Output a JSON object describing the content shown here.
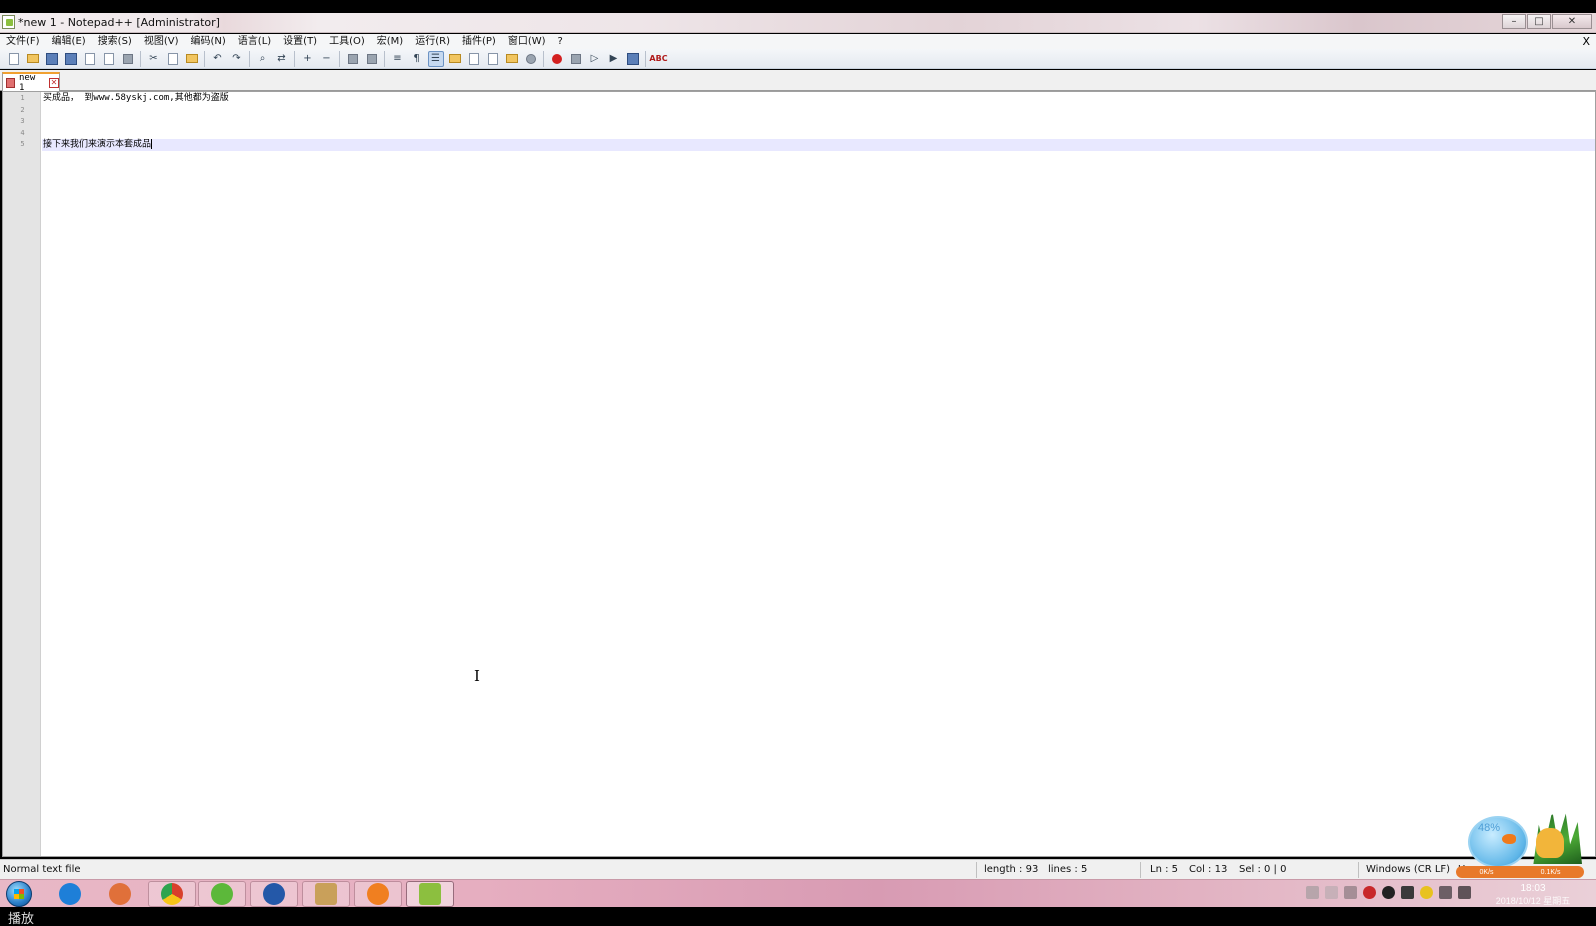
{
  "window": {
    "title": "*new 1 - Notepad++ [Administrator]",
    "buttons": {
      "minimize": "–",
      "maximize": "□",
      "close": "✕"
    }
  },
  "menu": {
    "items": [
      {
        "label": "文件(F)"
      },
      {
        "label": "编辑(E)"
      },
      {
        "label": "搜索(S)"
      },
      {
        "label": "视图(V)"
      },
      {
        "label": "编码(N)"
      },
      {
        "label": "语言(L)"
      },
      {
        "label": "设置(T)"
      },
      {
        "label": "工具(O)"
      },
      {
        "label": "宏(M)"
      },
      {
        "label": "运行(R)"
      },
      {
        "label": "插件(P)"
      },
      {
        "label": "窗口(W)"
      },
      {
        "label": "?"
      }
    ],
    "close_doc": "X"
  },
  "toolbar": {
    "icons": [
      "new-file-icon",
      "open-file-icon",
      "save-icon",
      "save-all-icon",
      "close-icon",
      "close-all-icon",
      "print-icon",
      "cut-icon",
      "copy-icon",
      "paste-icon",
      "undo-icon",
      "redo-icon",
      "find-icon",
      "replace-icon",
      "zoom-in-icon",
      "zoom-out-icon",
      "sync-vertical-icon",
      "sync-horizontal-icon",
      "word-wrap-icon",
      "show-all-chars-icon",
      "indent-guide-icon",
      "user-lang-icon",
      "doc-map-icon",
      "function-list-icon",
      "folder-workspace-icon",
      "monitoring-icon",
      "record-macro-icon",
      "stop-macro-icon",
      "play-macro-icon",
      "run-macro-multiple-icon",
      "save-macro-icon",
      "spell-check-icon"
    ],
    "spell_label": "ABC"
  },
  "tabs": [
    {
      "label": "new 1",
      "close": "✕"
    }
  ],
  "editor": {
    "line_numbers": [
      "1",
      "2",
      "3",
      "4",
      "5"
    ],
    "lines": [
      "买成品， 到www.58yskj.com,其他都为盗版",
      "",
      "",
      "",
      "接下来我们来演示本套成品"
    ],
    "current_line_index": 4,
    "cursor_glyph": "I"
  },
  "status": {
    "file_type": "Normal text file",
    "length": "length : 93",
    "lines": "lines : 5",
    "ln": "Ln : 5",
    "col": "Col : 13",
    "sel": "Sel : 0 | 0",
    "eol": "Windows (CR LF)",
    "encoding_partial": "U"
  },
  "pet_widget": {
    "percent": "48%",
    "up_speed": "0K/s",
    "down_speed": "0.1K/s"
  },
  "taskbar": {
    "apps": [
      {
        "name": "ie-icon",
        "color": "#1e7fd8"
      },
      {
        "name": "app-cluster-icon",
        "color": "#e0703a"
      },
      {
        "name": "chrome-icon",
        "color": "#d8402c"
      },
      {
        "name": "green-app-icon",
        "color": "#5cb83a"
      },
      {
        "name": "blue-s-app-icon",
        "color": "#2458a8"
      },
      {
        "name": "paint-app-icon",
        "color": "#c9a05a"
      },
      {
        "name": "cartoon-app-icon",
        "color": "#f07f20"
      },
      {
        "name": "notepadpp-icon",
        "color": "#8cbf3f"
      }
    ],
    "time": "18:03",
    "date": "2018/10/12 星期五"
  },
  "caption": "播放",
  "colors": {
    "current_line_bg": "#e8e8ff",
    "gutter_bg": "#e4e4e4",
    "tab_accent": "#f0a030"
  }
}
